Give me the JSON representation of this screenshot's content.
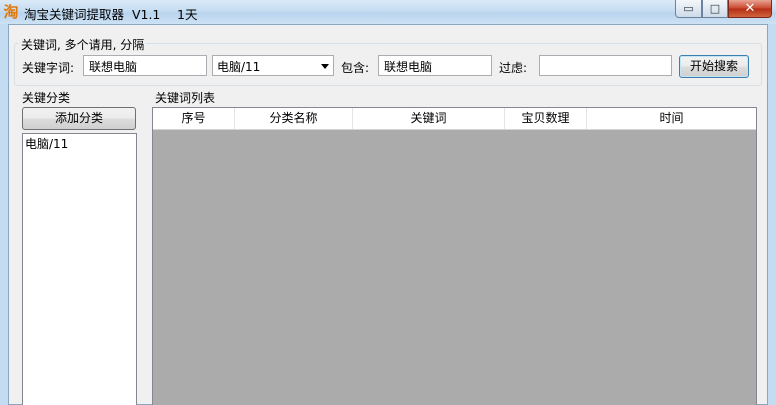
{
  "window": {
    "title": "淘宝关键词提取器  V1.1",
    "title_extra": "1天",
    "app_icon_glyph": "淘",
    "minimize_glyph": "▭",
    "maximize_glyph": "□",
    "close_glyph": "✕"
  },
  "keyword_group": {
    "legend": "关键词, 多个请用, 分隔",
    "keyword_label": "关键字词:",
    "keyword_value": "联想电脑",
    "category_select_value": "电脑/11",
    "include_label": "包含:",
    "include_value": "联想电脑",
    "filter_label": "过虑:",
    "filter_value": "",
    "search_button": "开始搜索"
  },
  "category_panel": {
    "title": "关键分类",
    "add_button": "添加分类",
    "items": [
      "电脑/11"
    ]
  },
  "keyword_list": {
    "title": "关键词列表",
    "columns": [
      "序号",
      "分类名称",
      "关键词",
      "宝贝数理",
      "时间"
    ],
    "rows": []
  },
  "colors": {
    "accent_icon": "#e07b10",
    "table_empty_bg": "#ababab"
  }
}
